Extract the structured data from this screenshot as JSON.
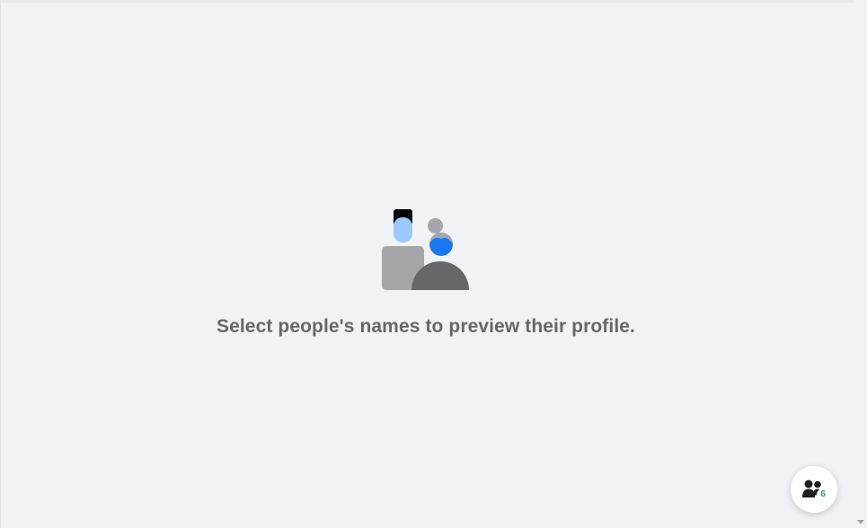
{
  "empty_state": {
    "illustration_icon": "people-illustration-icon",
    "message": "Select people's names to preview their profile."
  },
  "friends_button": {
    "icon": "friends-icon",
    "badge_count": "6",
    "badge_color": "#31a24c"
  },
  "colors": {
    "background": "#f0f2f5",
    "message_text": "#65676b",
    "accent_blue": "#1877f2"
  }
}
